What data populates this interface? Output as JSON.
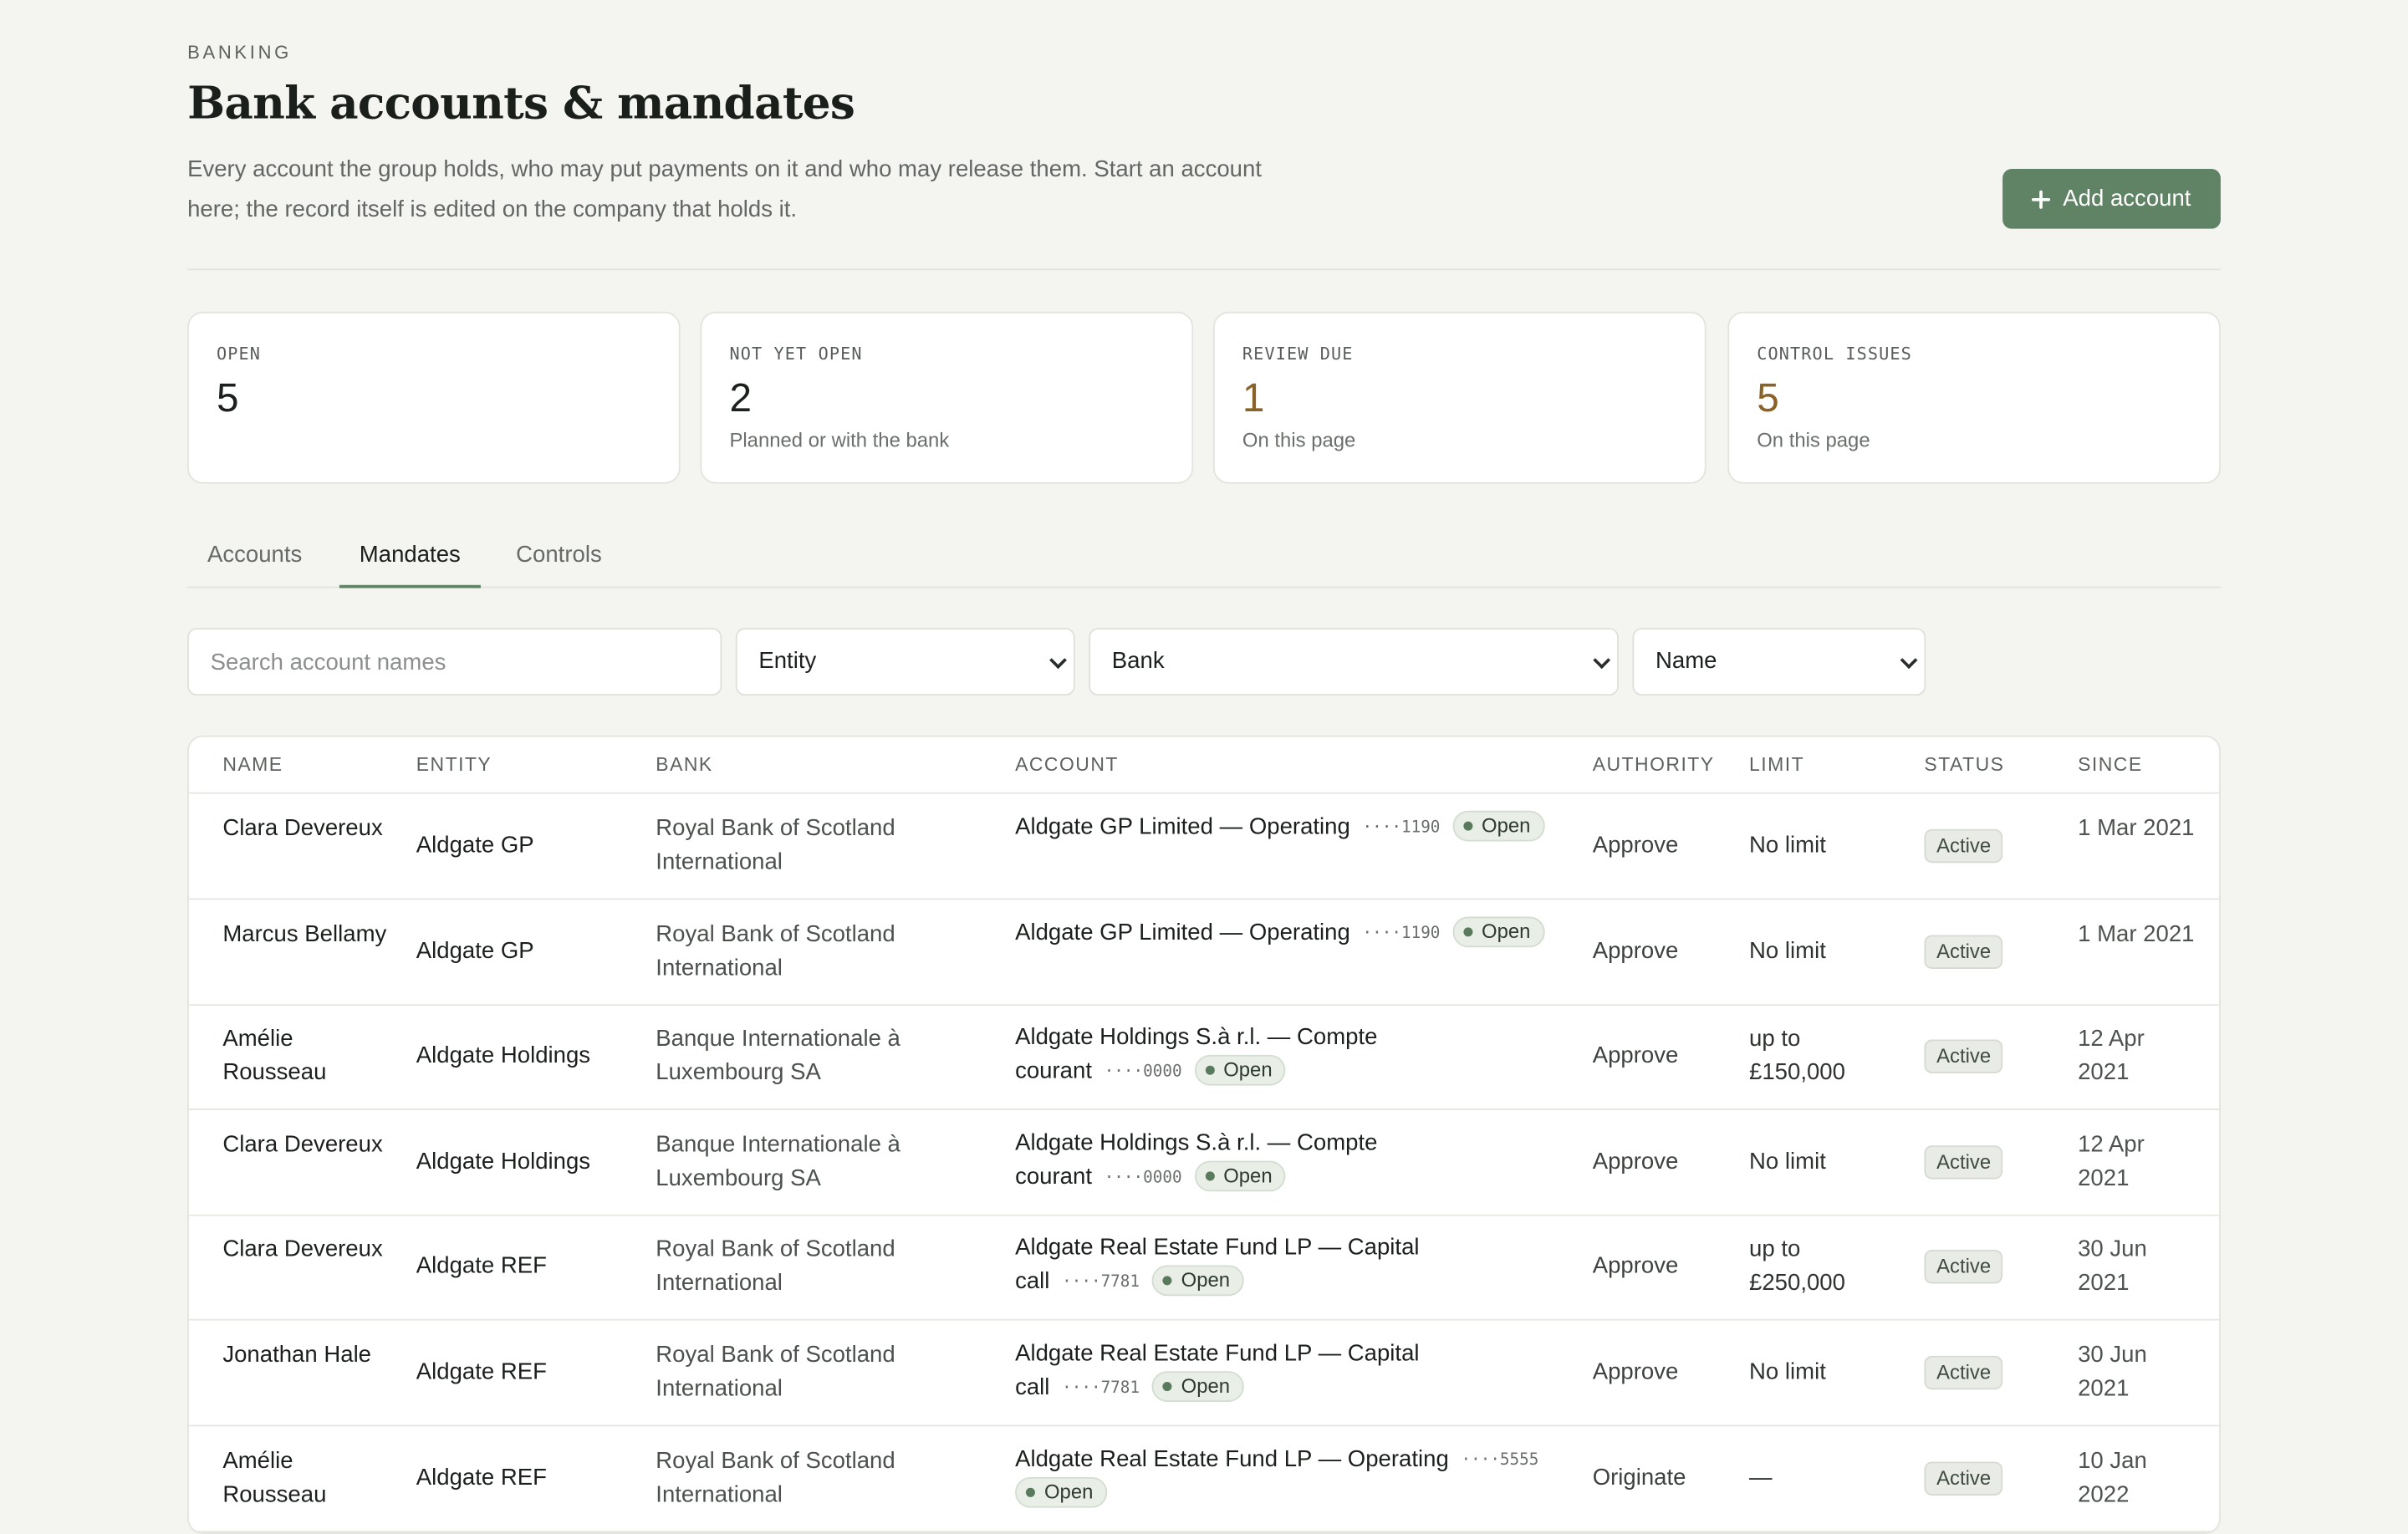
{
  "header": {
    "eyebrow": "BANKING",
    "title": "Bank accounts & mandates",
    "description": "Every account the group holds, who may put payments on it and who may release them. Start an account here; the record itself is edited on the company that holds it.",
    "add_button_label": "Add account"
  },
  "stats": [
    {
      "label": "OPEN",
      "value": "5",
      "sub": ""
    },
    {
      "label": "NOT YET OPEN",
      "value": "2",
      "sub": "Planned or with the bank"
    },
    {
      "label": "REVIEW DUE",
      "value": "1",
      "sub": "On this page"
    },
    {
      "label": "CONTROL ISSUES",
      "value": "5",
      "sub": "On this page"
    }
  ],
  "tabs": [
    {
      "label": "Accounts",
      "active": false
    },
    {
      "label": "Mandates",
      "active": true
    },
    {
      "label": "Controls",
      "active": false
    }
  ],
  "filters": {
    "search_placeholder": "Search account names",
    "entity": "Entity",
    "bank": "Bank",
    "sort": "Name"
  },
  "table": {
    "headers": [
      "NAME",
      "ENTITY",
      "BANK",
      "ACCOUNT",
      "AUTHORITY",
      "LIMIT",
      "STATUS",
      "SINCE"
    ],
    "rows": [
      {
        "name": "Clara Devereux",
        "entity": "Aldgate GP",
        "bank": "Royal Bank of Scotland International",
        "account": "Aldgate GP Limited — Operating",
        "account_no": "····1190",
        "account_status": "Open",
        "authority": "Approve",
        "limit": "No limit",
        "status": "Active",
        "since": "1 Mar 2021"
      },
      {
        "name": "Marcus Bellamy",
        "entity": "Aldgate GP",
        "bank": "Royal Bank of Scotland International",
        "account": "Aldgate GP Limited — Operating",
        "account_no": "····1190",
        "account_status": "Open",
        "authority": "Approve",
        "limit": "No limit",
        "status": "Active",
        "since": "1 Mar 2021"
      },
      {
        "name": "Amélie Rousseau",
        "entity": "Aldgate Holdings",
        "bank": "Banque Internationale à Luxembourg SA",
        "account": "Aldgate Holdings S.à r.l. — Compte courant",
        "account_no": "····0000",
        "account_status": "Open",
        "authority": "Approve",
        "limit": "up to £150,000",
        "status": "Active",
        "since": "12 Apr 2021"
      },
      {
        "name": "Clara Devereux",
        "entity": "Aldgate Holdings",
        "bank": "Banque Internationale à Luxembourg SA",
        "account": "Aldgate Holdings S.à r.l. — Compte courant",
        "account_no": "····0000",
        "account_status": "Open",
        "authority": "Approve",
        "limit": "No limit",
        "status": "Active",
        "since": "12 Apr 2021"
      },
      {
        "name": "Clara Devereux",
        "entity": "Aldgate REF",
        "bank": "Royal Bank of Scotland International",
        "account": "Aldgate Real Estate Fund LP — Capital call",
        "account_no": "····7781",
        "account_status": "Open",
        "authority": "Approve",
        "limit": "up to £250,000",
        "status": "Active",
        "since": "30 Jun 2021"
      },
      {
        "name": "Jonathan Hale",
        "entity": "Aldgate REF",
        "bank": "Royal Bank of Scotland International",
        "account": "Aldgate Real Estate Fund LP — Capital call",
        "account_no": "····7781",
        "account_status": "Open",
        "authority": "Approve",
        "limit": "No limit",
        "status": "Active",
        "since": "30 Jun 2021"
      },
      {
        "name": "Amélie Rousseau",
        "entity": "Aldgate REF",
        "bank": "Royal Bank of Scotland International",
        "account": "Aldgate Real Estate Fund LP — Operating",
        "account_no": "····5555",
        "account_status": "Open",
        "authority": "Originate",
        "limit": "—",
        "status": "Active",
        "since": "10 Jan 2022"
      }
    ]
  }
}
